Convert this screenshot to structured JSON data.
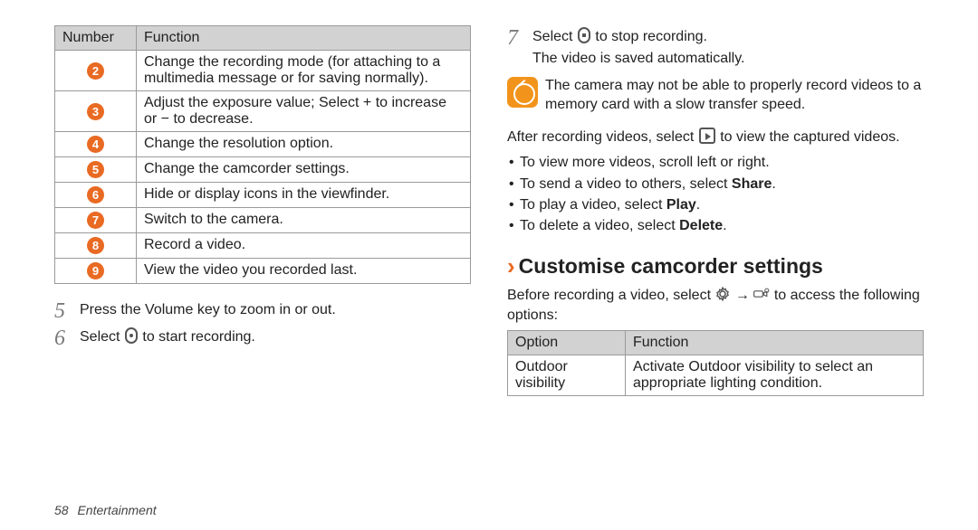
{
  "left_table": {
    "head_num": "Number",
    "head_fn": "Function",
    "rows": [
      {
        "n": "2",
        "fn": "Change the recording mode (for attaching to a multimedia message or for saving normally)."
      },
      {
        "n": "3",
        "fn": "Adjust the exposure value; Select + to increase or − to decrease."
      },
      {
        "n": "4",
        "fn": "Change the resolution option."
      },
      {
        "n": "5",
        "fn": "Change the camcorder settings."
      },
      {
        "n": "6",
        "fn": "Hide or display icons in the viewfinder."
      },
      {
        "n": "7",
        "fn": "Switch to the camera."
      },
      {
        "n": "8",
        "fn": "Record a video."
      },
      {
        "n": "9",
        "fn": "View the video you recorded last."
      }
    ]
  },
  "step5": {
    "num": "5",
    "text": "Press the Volume key to zoom in or out."
  },
  "step6": {
    "num": "6",
    "pre": "Select ",
    "post": " to start recording."
  },
  "step7": {
    "num": "7",
    "pre": "Select ",
    "post": " to stop recording.",
    "line2": "The video is saved automatically."
  },
  "note": "The camera may not be able to properly record videos to a memory card with a slow transfer speed.",
  "after_rec": {
    "pre": "After recording videos, select ",
    "post": " to view the captured videos."
  },
  "bullets": {
    "b1": "To view more videos, scroll left or right.",
    "b2_pre": "To send a video to others, select ",
    "b2_bold": "Share",
    "b2_post": ".",
    "b3_pre": "To play a video, select ",
    "b3_bold": "Play",
    "b3_post": ".",
    "b4_pre": "To delete a video, select ",
    "b4_bold": "Delete",
    "b4_post": "."
  },
  "heading": "Customise camcorder settings",
  "heading_intro": {
    "pre": "Before recording a video, select ",
    "mid": " → ",
    "post": " to access the following options:"
  },
  "opt_table": {
    "head_opt": "Option",
    "head_fn": "Function",
    "row1_opt": "Outdoor visibility",
    "row1_fn": "Activate Outdoor visibility to select an appropriate lighting condition."
  },
  "footer": {
    "page": "58",
    "section": "Entertainment"
  }
}
